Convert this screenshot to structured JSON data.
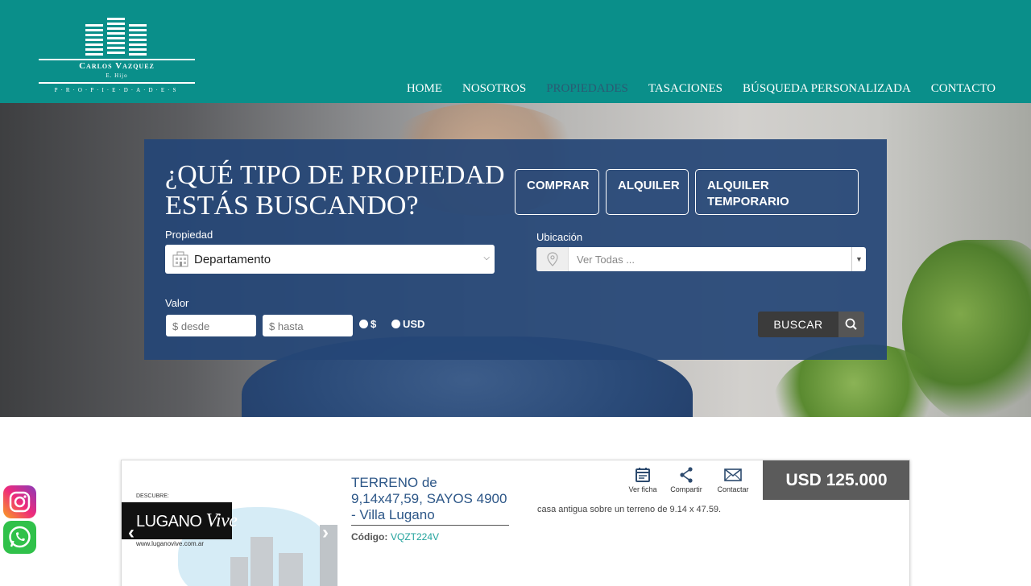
{
  "brand": {
    "name": "Carlos Vazquez",
    "sub": "E. Hijo",
    "tagline": "P·R·O·P·I·E·D·A·D·E·S"
  },
  "nav": {
    "items": [
      "HOME",
      "NOSOTROS",
      "PROPIEDADES",
      "TASACIONES",
      "BÚSQUEDA PERSONALIZADA",
      "CONTACTO"
    ],
    "active": "PROPIEDADES"
  },
  "search": {
    "title_line1": "¿QUÉ TIPO DE PROPIEDAD",
    "title_line2": "ESTÁS BUSCANDO?",
    "operations": [
      "COMPRAR",
      "ALQUILER",
      "ALQUILER TEMPORARIO"
    ],
    "propiedad_label": "Propiedad",
    "propiedad_value": "Departamento",
    "ubicacion_label": "Ubicación",
    "ubicacion_placeholder": "Ver Todas ...",
    "valor_label": "Valor",
    "desde_placeholder": "$ desde",
    "hasta_placeholder": "$ hasta",
    "currency_options": [
      "$",
      "USD"
    ],
    "buscar_label": "BUSCAR"
  },
  "social": {
    "instagram_icon": "instagram-icon",
    "whatsapp_icon": "whatsapp-icon"
  },
  "listing": {
    "image": {
      "descubre": "DESCUBRE:",
      "logo_lugano": "LUGANO",
      "logo_vive": "Vive",
      "url": "www.luganovive.com.ar"
    },
    "title": "TERRENO de 9,14x47,59, SAYOS 4900 - Villa Lugano",
    "code_label": "Código:",
    "code": "VQZT224V",
    "description": "casa antigua sobre un terreno de 9.14 x 47.59.",
    "actions": [
      "Ver ficha",
      "Compartir",
      "Contactar"
    ],
    "price": "USD 125.000"
  },
  "colors": {
    "header": "#0a8f8a",
    "panel": "#254676",
    "nav_active": "#2b5a73",
    "title_blue": "#2c5687",
    "code_teal": "#20a29c",
    "price_bg": "#5b5b5b"
  }
}
